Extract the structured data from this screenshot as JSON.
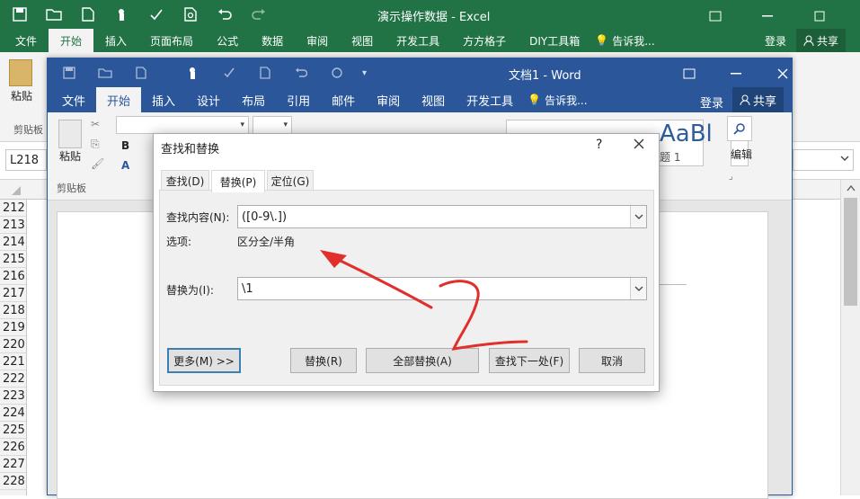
{
  "excel": {
    "title": "演示操作数据 - Excel",
    "tabs": [
      "文件",
      "开始",
      "插入",
      "页面布局",
      "公式",
      "数据",
      "审阅",
      "视图",
      "开发工具",
      "方方格子",
      "DIY工具箱"
    ],
    "tell_me": "告诉我...",
    "login": "登录",
    "share": "共享",
    "paste_label": "粘贴",
    "clipboard_label": "剪贴板",
    "name_box": "L218",
    "row_numbers": [
      "212",
      "213",
      "214",
      "215",
      "216",
      "217",
      "218",
      "219",
      "220",
      "221",
      "222",
      "223",
      "224",
      "225",
      "226",
      "227",
      "228"
    ]
  },
  "word": {
    "title": "文档1 - Word",
    "tabs": [
      "文件",
      "开始",
      "插入",
      "设计",
      "布局",
      "引用",
      "邮件",
      "审阅",
      "视图",
      "开发工具"
    ],
    "tell_me": "告诉我...",
    "login": "登录",
    "share": "共享",
    "paste_label": "粘贴",
    "clipboard_label": "剪贴板",
    "style_preview": "AaBl",
    "style_caption": "题 1",
    "edit_label": "编辑"
  },
  "dialog": {
    "title": "查找和替换",
    "help": "?",
    "tabs": [
      "查找(D)",
      "替换(P)",
      "定位(G)"
    ],
    "find_label": "查找内容(N):",
    "find_value": "([0-9\\.])",
    "options_label": "选项:",
    "options_value": "区分全/半角",
    "replace_label": "替换为(I):",
    "replace_value": "\\1",
    "buttons": {
      "more": "更多(M) >>",
      "replace": "替换(R)",
      "replace_all": "全部替换(A)",
      "find_next": "查找下一处(F)",
      "cancel": "取消"
    }
  },
  "colors": {
    "excel_green": "#217346",
    "word_blue": "#2b579a",
    "annotation_red": "#e0302c"
  }
}
